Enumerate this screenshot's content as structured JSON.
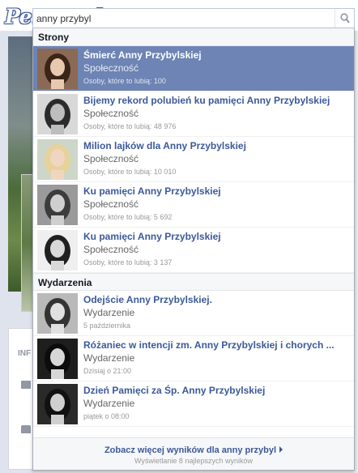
{
  "logo": {
    "text": "Penerapl"
  },
  "search": {
    "value": "anny przybyl",
    "placeholder": ""
  },
  "dropdown": {
    "pages_header": "Strony",
    "pages": [
      {
        "title": "Śmierć Anny Przybylskiej",
        "category": "Społeczność",
        "meta": "Osoby, które to lubią: 100",
        "thumb_icon": "person-photo",
        "selected": true
      },
      {
        "title": "Bijemy rekord polubień ku pamięci Anny Przybylskiej",
        "category": "Społeczność",
        "meta": "Osoby, które to lubią: 48 976",
        "thumb_icon": "person-photo"
      },
      {
        "title": "Milion lajków dla Anny Przybylskiej",
        "category": "Społeczność",
        "meta": "Osoby, które to lubią: 10 010",
        "thumb_icon": "person-photo"
      },
      {
        "title": "Ku pamięci Anny Przybylskiej",
        "category": "Społeczność",
        "meta": "Osoby, które to lubią: 5 692",
        "thumb_icon": "person-photo"
      },
      {
        "title": "Ku pamięci Anny Przybylskiej",
        "category": "Społeczność",
        "meta": "Osoby, które to lubią: 3 137",
        "thumb_icon": "person-photo"
      }
    ],
    "events_header": "Wydarzenia",
    "events": [
      {
        "title": "Odejście Anny Przybylskiej.",
        "category": "Wydarzenie",
        "meta": "5 października",
        "thumb_icon": "person-photo"
      },
      {
        "title": "Różaniec w intencji zm. Anny Przybylskiej i chorych ...",
        "category": "Wydarzenie",
        "meta": "Dzisiaj o 21:00",
        "thumb_icon": "person-photo"
      },
      {
        "title": "Dzień Pamięci za Śp. Anny Przybylskiej",
        "category": "Wydarzenie",
        "meta": "piątek o 08:00",
        "thumb_icon": "person-photo"
      }
    ],
    "more_link": "Zobacz więcej wyników dla anny przybyl",
    "footer_note": "Wyświetlanie 8 najlepszych wyników"
  },
  "background": {
    "info_label": "INF"
  },
  "colors": {
    "fb_blue": "#3b5998",
    "selected_bg": "#6d84b4"
  }
}
